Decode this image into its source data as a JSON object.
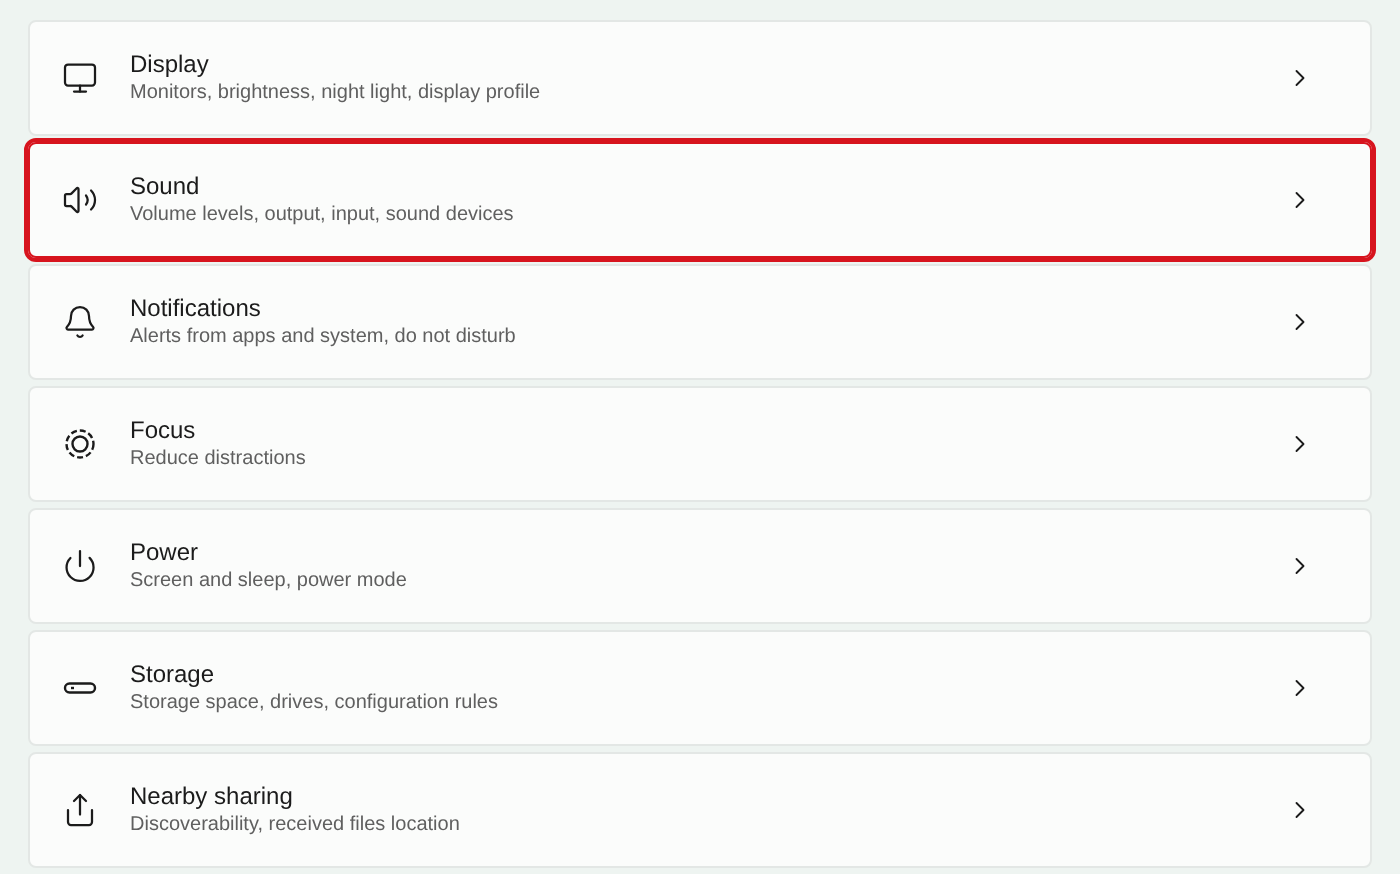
{
  "settings": [
    {
      "title": "Display",
      "description": "Monitors, brightness, night light, display profile",
      "highlighted": false
    },
    {
      "title": "Sound",
      "description": "Volume levels, output, input, sound devices",
      "highlighted": true
    },
    {
      "title": "Notifications",
      "description": "Alerts from apps and system, do not disturb",
      "highlighted": false
    },
    {
      "title": "Focus",
      "description": "Reduce distractions",
      "highlighted": false
    },
    {
      "title": "Power",
      "description": "Screen and sleep, power mode",
      "highlighted": false
    },
    {
      "title": "Storage",
      "description": "Storage space, drives, configuration rules",
      "highlighted": false
    },
    {
      "title": "Nearby sharing",
      "description": "Discoverability, received files location",
      "highlighted": false
    }
  ]
}
